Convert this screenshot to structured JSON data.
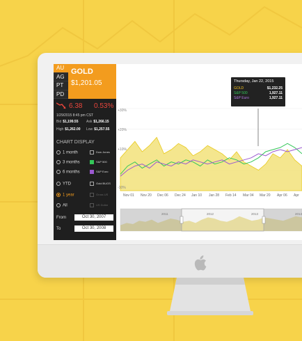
{
  "colors": {
    "background": "#f7d34a",
    "accent_orange": "#f39c1e",
    "gold_series": "#f0d93a",
    "sp500_series": "#34c759",
    "spuro_series": "#9b59d0",
    "down_red": "#e8453c"
  },
  "metals": [
    "AU",
    "AG",
    "PT",
    "PD"
  ],
  "header": {
    "name": "GOLD",
    "price": "$1,201.05"
  },
  "change": {
    "icon": "trend-down-icon",
    "abs": "6.38",
    "pct": "0.53%"
  },
  "timestamp": "1/29/2015 8:45 pm CST",
  "quote": {
    "bid_label": "Bid",
    "bid": "$1,199.55",
    "ask_label": "Ask",
    "ask": "$1,266.15",
    "high_label": "High",
    "high": "$1,262.00",
    "low_label": "Low",
    "low": "$1,257.55"
  },
  "chart_display_title": "CHART DISPLAY",
  "ranges": [
    "1 month",
    "3 months",
    "6 months",
    "YTD",
    "1 year",
    "All"
  ],
  "selected_range": "1 year",
  "overlays": [
    "Dow Jones",
    "S&P 500",
    "S&P Euro",
    "Gold BUGS",
    "Gross US",
    "US Dollar"
  ],
  "date_range": {
    "from_label": "From",
    "from": "Oct 30, 2007",
    "to_label": "To",
    "to": "Oct 30, 2008"
  },
  "tooltip": {
    "date": "Thursday, Jan 22, 2015",
    "rows": [
      {
        "name": "GOLD",
        "value": "$1,232.25"
      },
      {
        "name": "S&P 500",
        "value": "1,927.11"
      },
      {
        "name": "S&P Euro",
        "value": "1,927.11"
      }
    ]
  },
  "chart_data": {
    "type": "area",
    "x_ticks": [
      "Nov 01",
      "Nov 20",
      "Dec 06",
      "Dec 24",
      "Jan 10",
      "Jan 28",
      "Feb 14",
      "Mar 04",
      "Mar 20",
      "Apr 06",
      "Apr"
    ],
    "y_ticks": [
      "+30%",
      "+20%",
      "+10%",
      "0%",
      "-10%"
    ],
    "ylim": [
      -10,
      30
    ],
    "navigator_years": [
      "2011",
      "2012",
      "2013",
      "2014"
    ],
    "series": [
      {
        "name": "GOLD",
        "values": [
          6,
          10,
          14,
          9,
          12,
          16,
          8,
          10,
          13,
          11,
          7,
          9,
          12,
          10,
          8,
          5,
          9,
          4,
          2,
          0,
          3,
          8,
          6,
          10,
          5,
          2
        ]
      },
      {
        "name": "S&P 500",
        "values": [
          -2,
          2,
          4,
          1,
          3,
          5,
          2,
          4,
          3,
          5,
          4,
          2,
          5,
          3,
          4,
          6,
          5,
          3,
          4,
          6,
          9,
          10,
          11,
          13,
          11,
          8
        ]
      },
      {
        "name": "S&P Euro",
        "values": [
          -3,
          0,
          2,
          3,
          1,
          4,
          3,
          2,
          4,
          3,
          5,
          4,
          3,
          4,
          5,
          3,
          4,
          5,
          6,
          8,
          7,
          9,
          10,
          9,
          10,
          11
        ]
      }
    ]
  }
}
